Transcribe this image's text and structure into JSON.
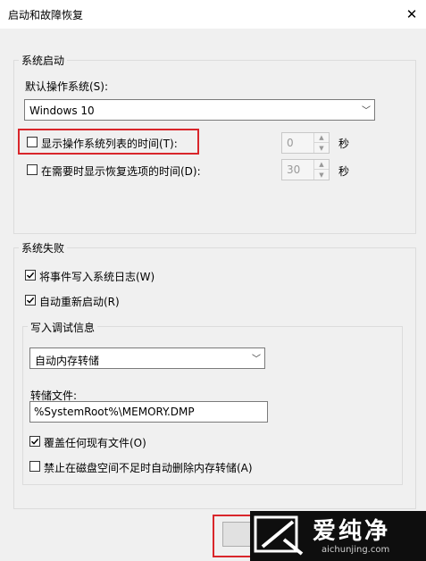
{
  "window": {
    "title": "启动和故障恢复"
  },
  "system_startup": {
    "group_label": "系统启动",
    "default_os_label": "默认操作系统(S):",
    "default_os_value": "Windows 10",
    "show_os_list": {
      "label": "显示操作系统列表的时间(T):",
      "checked": false,
      "value": "0",
      "unit": "秒"
    },
    "show_recovery": {
      "label": "在需要时显示恢复选项的时间(D):",
      "checked": false,
      "value": "30",
      "unit": "秒"
    }
  },
  "system_failure": {
    "group_label": "系统失败",
    "write_event": {
      "label": "将事件写入系统日志(W)",
      "checked": true
    },
    "auto_restart": {
      "label": "自动重新启动(R)",
      "checked": true
    },
    "debug_info": {
      "group_label": "写入调试信息",
      "dump_type_value": "自动内存转储",
      "dump_file_label": "转储文件:",
      "dump_file_value": "%SystemRoot%\\MEMORY.DMP",
      "overwrite": {
        "label": "覆盖任何现有文件(O)",
        "checked": true
      },
      "disable_auto_delete": {
        "label": "禁止在磁盘空间不足时自动删除内存转储(A)",
        "checked": false
      }
    }
  },
  "watermark": {
    "brand": "爱纯净",
    "url": "aichunjing.com"
  },
  "colors": {
    "highlight": "#d9262b",
    "window_bg": "#f0f0f0"
  }
}
